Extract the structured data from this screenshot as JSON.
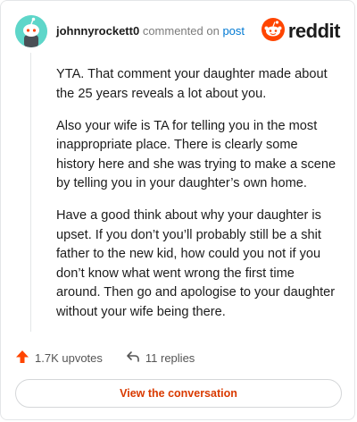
{
  "header": {
    "author": "johnnyrockett0",
    "commented_on": "commented on",
    "post_link": "post",
    "brand": "reddit",
    "avatar_icon": "snoo-avatar-icon",
    "brand_icon": "reddit-logo-icon",
    "colors": {
      "avatar_bg": "#5ed6c9",
      "brand": "#ff4500",
      "link": "#0079d3"
    }
  },
  "comment": {
    "paragraphs": [
      "YTA. That comment your daughter made about the 25 years reveals a lot about you.",
      "Also your wife is TA for telling you in the most inappropriate place. There is clearly some history here and she was trying to make a scene by telling you in your daughter’s own home.",
      "Have a good think about why your daughter is upset. If you don’t you’ll probably still be a shit father to the new kid, how could you not if you don’t know what went wrong the first time around. Then go and apologise to your daughter without your wife being there."
    ]
  },
  "actions": {
    "upvotes": "1.7K upvotes",
    "upvote_icon": "upvote-arrow-icon",
    "replies": "11 replies",
    "reply_icon": "reply-arrow-icon",
    "colors": {
      "upvote": "#ff4500"
    }
  },
  "footer": {
    "view_conversation": "View the conversation",
    "colors": {
      "button_text": "#d93a00"
    }
  }
}
